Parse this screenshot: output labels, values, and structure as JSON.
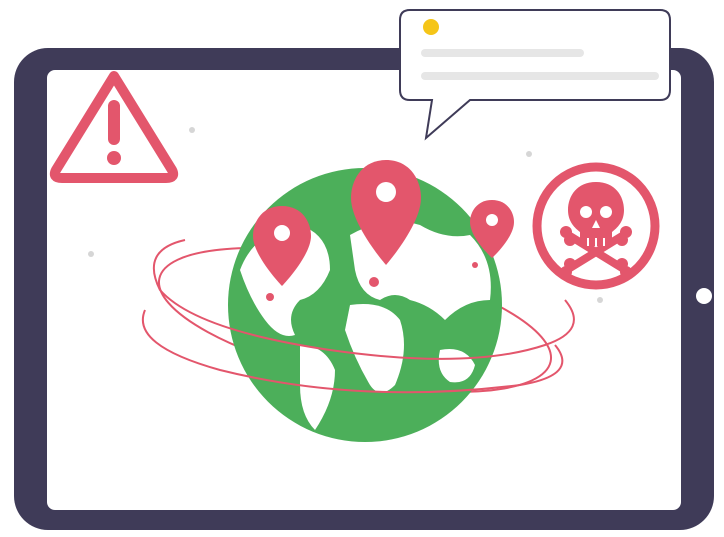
{
  "illustration": {
    "theme": "global-security-threat",
    "device": "tablet",
    "elements": {
      "warning": "warning-triangle-icon",
      "notification": "speech-bubble-notification",
      "globe": "world-globe",
      "pins": [
        "location-pin-icon",
        "location-pin-icon",
        "location-pin-icon"
      ],
      "danger": "skull-crossbones-icon"
    }
  },
  "colors": {
    "device_frame": "#3f3b58",
    "screen": "#ffffff",
    "accent_red": "#e3566c",
    "globe_green": "#4caf5a",
    "land_white": "#ffffff",
    "notification_dot": "#f5c518",
    "placeholder_gray": "#e6e6e6",
    "dot_gray": "#d6d6d6"
  }
}
